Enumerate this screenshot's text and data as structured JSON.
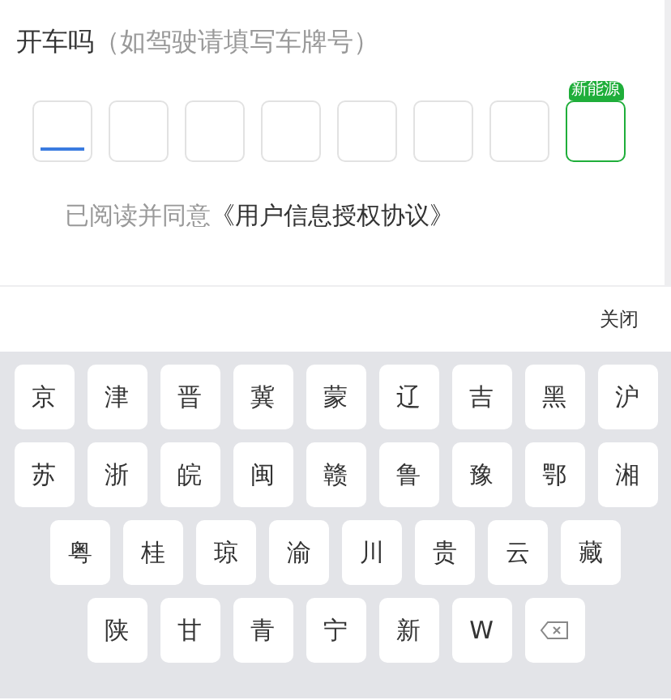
{
  "question": {
    "title": "开车吗",
    "hint": "（如驾驶请填写车牌号）"
  },
  "plate_slots": [
    {
      "kind": "cell",
      "focused": true
    },
    {
      "kind": "cell",
      "focused": false
    },
    {
      "kind": "cell",
      "focused": false
    },
    {
      "kind": "cell",
      "focused": false
    },
    {
      "kind": "cell",
      "focused": false
    },
    {
      "kind": "cell",
      "focused": false
    },
    {
      "kind": "cell",
      "focused": false
    },
    {
      "kind": "new_energy",
      "focused": false,
      "badge": "新能源"
    }
  ],
  "agreement": {
    "text": "已阅读并同意",
    "link": "《用户信息授权协议》"
  },
  "keyboard": {
    "close_button": "关闭",
    "rows": [
      {
        "keys": [
          {
            "kind": "char",
            "label": "京"
          },
          {
            "kind": "char",
            "label": "津"
          },
          {
            "kind": "char",
            "label": "晋"
          },
          {
            "kind": "char",
            "label": "冀"
          },
          {
            "kind": "char",
            "label": "蒙"
          },
          {
            "kind": "char",
            "label": "辽"
          },
          {
            "kind": "char",
            "label": "吉"
          },
          {
            "kind": "char",
            "label": "黑"
          },
          {
            "kind": "char",
            "label": "沪"
          }
        ]
      },
      {
        "keys": [
          {
            "kind": "char",
            "label": "苏"
          },
          {
            "kind": "char",
            "label": "浙"
          },
          {
            "kind": "char",
            "label": "皖"
          },
          {
            "kind": "char",
            "label": "闽"
          },
          {
            "kind": "char",
            "label": "赣"
          },
          {
            "kind": "char",
            "label": "鲁"
          },
          {
            "kind": "char",
            "label": "豫"
          },
          {
            "kind": "char",
            "label": "鄂"
          },
          {
            "kind": "char",
            "label": "湘"
          }
        ]
      },
      {
        "keys": [
          {
            "kind": "char",
            "label": "粤"
          },
          {
            "kind": "char",
            "label": "桂"
          },
          {
            "kind": "char",
            "label": "琼"
          },
          {
            "kind": "char",
            "label": "渝"
          },
          {
            "kind": "char",
            "label": "川"
          },
          {
            "kind": "char",
            "label": "贵"
          },
          {
            "kind": "char",
            "label": "云"
          },
          {
            "kind": "char",
            "label": "藏"
          }
        ]
      },
      {
        "keys": [
          {
            "kind": "char",
            "label": "陕"
          },
          {
            "kind": "char",
            "label": "甘"
          },
          {
            "kind": "char",
            "label": "青"
          },
          {
            "kind": "char",
            "label": "宁"
          },
          {
            "kind": "char",
            "label": "新"
          },
          {
            "kind": "char",
            "label": "W"
          },
          {
            "kind": "delete"
          }
        ]
      }
    ]
  }
}
